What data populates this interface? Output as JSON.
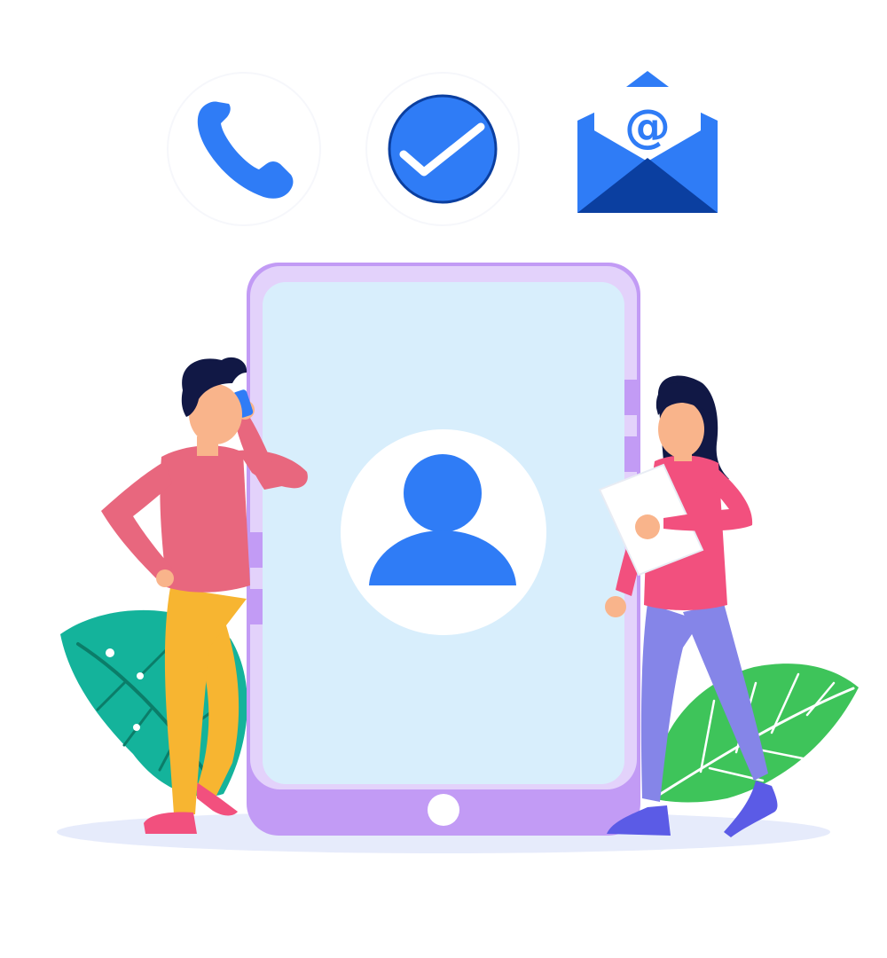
{
  "scene": {
    "icons": [
      "phone-icon",
      "check-icon",
      "email-icon"
    ],
    "email_symbol": "@"
  },
  "colors": {
    "primary_blue": "#2f7cf6",
    "dark_blue": "#0b3fa0",
    "device_frame": "#c29bf5",
    "device_screen": "#d8eefc",
    "leaf_teal": "#14b39b",
    "leaf_green": "#3ec45a",
    "man_shirt": "#e8677e",
    "man_pants": "#f7b531",
    "woman_shirt": "#f2507e",
    "woman_pants": "#8585e8",
    "skin": "#f9b48b",
    "hair": "#111845",
    "ground": "#e6ebfb"
  }
}
